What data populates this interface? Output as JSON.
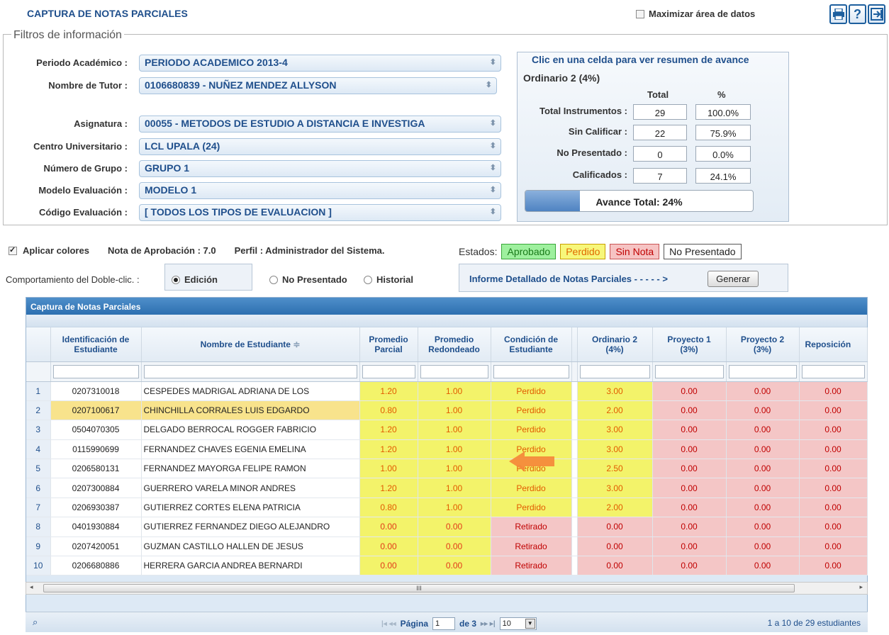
{
  "header": {
    "title": "CAPTURA DE NOTAS PARCIALES",
    "maximize_label": "Maximizar área de datos",
    "toolbar": {
      "print_glyph": "🖶",
      "help_glyph": "?",
      "exit_glyph": "⇥"
    }
  },
  "filters": {
    "legend": "Filtros de información",
    "periodo": {
      "label": "Periodo Académico :",
      "value": "PERIODO ACADEMICO 2013-4"
    },
    "tutor": {
      "label": "Nombre de Tutor :",
      "value": "0106680839 - NUÑEZ MENDEZ ALLYSON"
    },
    "asignatura": {
      "label": "Asignatura :",
      "value": "00055 - METODOS DE ESTUDIO A DISTANCIA E INVESTIGA"
    },
    "centro": {
      "label": "Centro Universitario :",
      "value": "LCL UPALA (24)"
    },
    "grupo": {
      "label": "Número de Grupo :",
      "value": "GRUPO 1"
    },
    "modelo": {
      "label": "Modelo Evaluación :",
      "value": "MODELO 1"
    },
    "codigo": {
      "label": "Código Evaluación :",
      "value": "[ TODOS LOS TIPOS DE EVALUACION ]"
    }
  },
  "summary": {
    "caption": "Clic en una celda para ver resumen de avance",
    "subtitle": "Ordinario 2 (4%)",
    "col_total": "Total",
    "col_pct": "%",
    "rows": [
      {
        "label": "Total Instrumentos :",
        "total": "29",
        "pct": "100.0%"
      },
      {
        "label": "Sin Calificar :",
        "total": "22",
        "pct": "75.9%"
      },
      {
        "label": "No Presentado :",
        "total": "0",
        "pct": "0.0%"
      },
      {
        "label": "Calificados :",
        "total": "7",
        "pct": "24.1%"
      }
    ],
    "progress_label": "Avance Total: 24%",
    "progress_fraction": 0.24
  },
  "options": {
    "apply_colors": "Aplicar colores",
    "nota_aprobacion": "Nota de Aprobación : 7.0",
    "perfil": "Perfil : Administrador del Sistema.",
    "estados_label": "Estados:",
    "estados": [
      {
        "label": "Aprobado",
        "bg": "#9ef09e",
        "color": "#1a7a1a",
        "border": "#3aa63a"
      },
      {
        "label": "Perdido",
        "bg": "#f7f77a",
        "color": "#e06a00",
        "border": "#c9a000"
      },
      {
        "label": "Sin Nota",
        "bg": "#f6c3c3",
        "color": "#c00000",
        "border": "#c95555"
      },
      {
        "label": "No Presentado",
        "bg": "#ffffff",
        "color": "#222222",
        "border": "#555555"
      }
    ],
    "doble_clic_label": "Comportamiento del Doble-clic. :",
    "radio_edicion": "Edición",
    "radio_no_presentado": "No Presentado",
    "radio_historial": "Historial",
    "report_label": "Informe Detallado de Notas Parciales - - - - - >",
    "generate_button": "Generar"
  },
  "grid": {
    "title": "Captura de Notas Parciales",
    "columns": {
      "id": "Identificación de Estudiante",
      "name": "Nombre de Estudiante",
      "prom_parcial": "Promedio Parcial",
      "prom_redondeado": "Promedio Redondeado",
      "condicion": "Condición de Estudiante",
      "ordinario2": "Ordinario 2 (4%)",
      "proyecto1": "Proyecto 1 (3%)",
      "proyecto2": "Proyecto 2 (3%)",
      "reposicion": "Reposición"
    },
    "sort_glyph": "≑",
    "rows": [
      {
        "n": "1",
        "id": "0207310018",
        "name": "CESPEDES MADRIGAL ADRIANA DE LOS",
        "pp": "1.20",
        "pr": "1.00",
        "cond": "Perdido",
        "ord2": "3.00",
        "p1": "0.00",
        "p2": "0.00",
        "rep": "0.00"
      },
      {
        "n": "2",
        "id": "0207100617",
        "name": "CHINCHILLA CORRALES LUIS EDGARDO",
        "pp": "0.80",
        "pr": "1.00",
        "cond": "Perdido",
        "ord2": "2.00",
        "p1": "0.00",
        "p2": "0.00",
        "rep": "0.00"
      },
      {
        "n": "3",
        "id": "0504070305",
        "name": "DELGADO BERROCAL ROGGER FABRICIO",
        "pp": "1.20",
        "pr": "1.00",
        "cond": "Perdido",
        "ord2": "3.00",
        "p1": "0.00",
        "p2": "0.00",
        "rep": "0.00"
      },
      {
        "n": "4",
        "id": "0115990699",
        "name": "FERNANDEZ CHAVES EGENIA EMELINA",
        "pp": "1.20",
        "pr": "1.00",
        "cond": "Perdido",
        "ord2": "3.00",
        "p1": "0.00",
        "p2": "0.00",
        "rep": "0.00"
      },
      {
        "n": "5",
        "id": "0206580131",
        "name": "FERNANDEZ MAYORGA FELIPE RAMON",
        "pp": "1.00",
        "pr": "1.00",
        "cond": "Perdido",
        "ord2": "2.50",
        "p1": "0.00",
        "p2": "0.00",
        "rep": "0.00"
      },
      {
        "n": "6",
        "id": "0207300884",
        "name": "GUERRERO VARELA MINOR ANDRES",
        "pp": "1.20",
        "pr": "1.00",
        "cond": "Perdido",
        "ord2": "3.00",
        "p1": "0.00",
        "p2": "0.00",
        "rep": "0.00"
      },
      {
        "n": "7",
        "id": "0206930387",
        "name": "GUTIERREZ CORTES ELENA PATRICIA",
        "pp": "0.80",
        "pr": "1.00",
        "cond": "Perdido",
        "ord2": "2.00",
        "p1": "0.00",
        "p2": "0.00",
        "rep": "0.00"
      },
      {
        "n": "8",
        "id": "0401930884",
        "name": "GUTIERREZ FERNANDEZ DIEGO ALEJANDRO",
        "pp": "0.00",
        "pr": "0.00",
        "cond": "Retirado",
        "ord2": "0.00",
        "p1": "0.00",
        "p2": "0.00",
        "rep": "0.00"
      },
      {
        "n": "9",
        "id": "0207420051",
        "name": "GUZMAN CASTILLO HALLEN DE JESUS",
        "pp": "0.00",
        "pr": "0.00",
        "cond": "Retirado",
        "ord2": "0.00",
        "p1": "0.00",
        "p2": "0.00",
        "rep": "0.00"
      },
      {
        "n": "10",
        "id": "0206680886",
        "name": "HERRERA GARCIA ANDREA BERNARDI",
        "pp": "0.00",
        "pr": "0.00",
        "cond": "Retirado",
        "ord2": "0.00",
        "p1": "0.00",
        "p2": "0.00",
        "rep": "0.00"
      }
    ],
    "scroll_grip": "III"
  },
  "pager": {
    "search_glyph": "⌕",
    "first_prev": "|◂ ◂◂",
    "page_label": "Página",
    "page_value": "1",
    "of_label": "de 3",
    "next_last": "▸▸ ▸|",
    "rows_value": "10",
    "info": "1 a 10 de 29 estudiantes"
  }
}
